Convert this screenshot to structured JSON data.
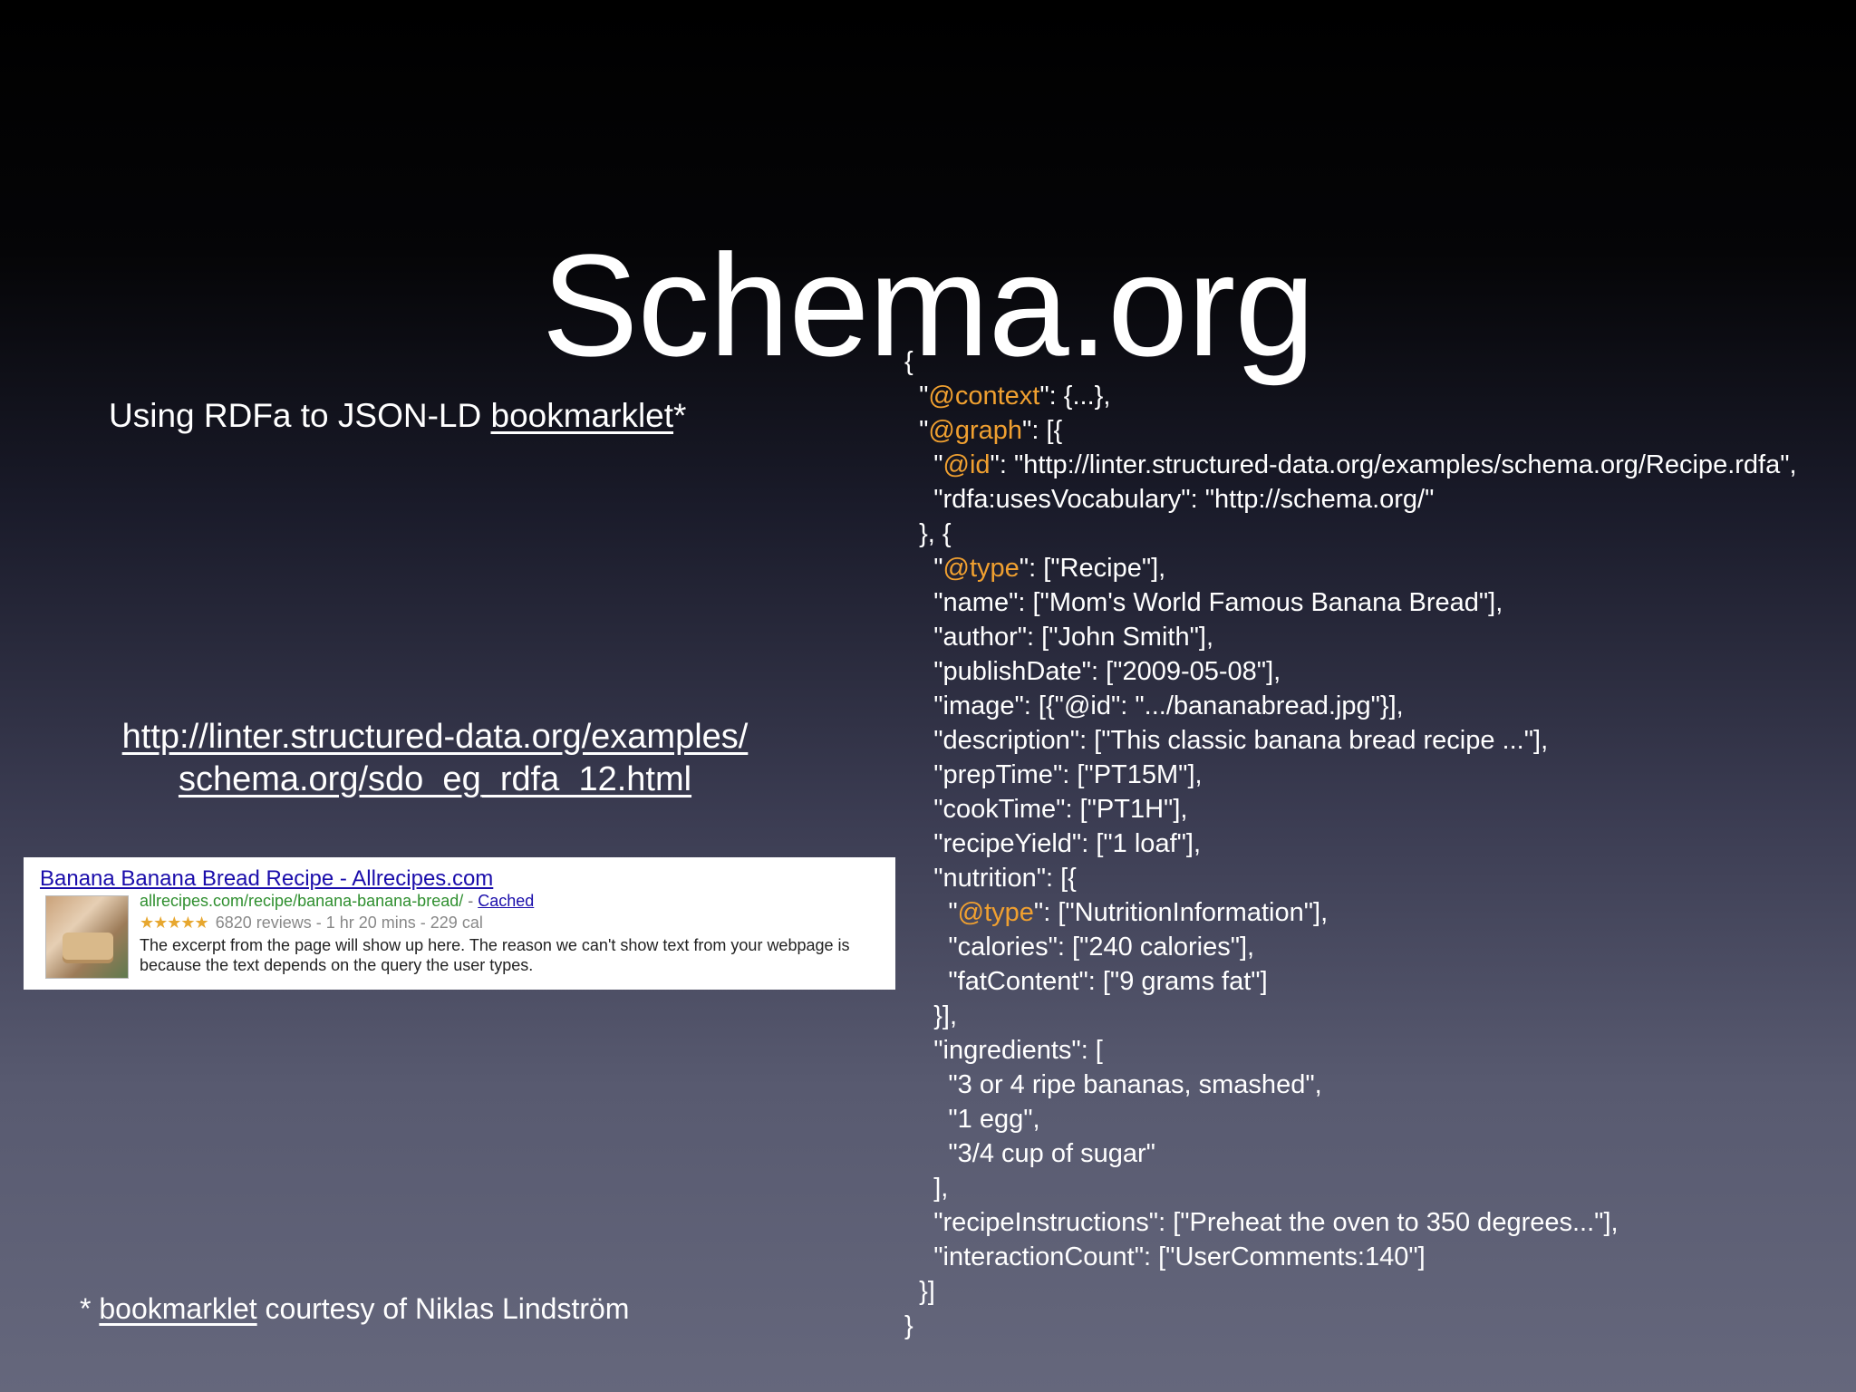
{
  "slide": {
    "title": "Schema.org",
    "subtitle": {
      "prefix": "Using RDFa to JSON-LD ",
      "link": "bookmarklet",
      "suffix": "*"
    },
    "url": {
      "line1": "http://linter.structured-data.org/examples/",
      "line2": "schema.org/sdo_eg_rdfa_12.html"
    },
    "footnote": {
      "prefix": "* ",
      "link": "bookmarklet",
      "suffix": " courtesy of Niklas Lindström"
    }
  },
  "search_result": {
    "title": "Banana Banana Bread Recipe - Allrecipes.com",
    "url": "allrecipes.com/recipe/banana-banana-bread/",
    "separator": " - ",
    "cached_label": "Cached",
    "stars": "★★★★★",
    "meta": "6820 reviews - 1 hr 20 mins - 229 cal",
    "description": "The excerpt from the page will show up here. The reason we can't show text from your webpage is because the text depends on the query the user types.",
    "thumbnail": "banana-bread-photo"
  },
  "code": {
    "lines": [
      {
        "indent": "",
        "key": "",
        "rest": "{"
      },
      {
        "indent": "  ",
        "key": "@context",
        "rest": ": {...},"
      },
      {
        "indent": "  ",
        "key": "@graph",
        "rest": ": [{"
      },
      {
        "indent": "    ",
        "key": "@id",
        "rest": ": \"http://linter.structured-data.org/examples/schema.org/Recipe.rdfa\","
      },
      {
        "indent": "    ",
        "key": "",
        "rest": "\"rdfa:usesVocabulary\": \"http://schema.org/\""
      },
      {
        "indent": "  ",
        "key": "",
        "rest": "}, {"
      },
      {
        "indent": "    ",
        "key": "@type",
        "rest": ": [\"Recipe\"],"
      },
      {
        "indent": "    ",
        "key": "",
        "rest": "\"name\": [\"Mom's World Famous Banana Bread\"],"
      },
      {
        "indent": "    ",
        "key": "",
        "rest": "\"author\": [\"John Smith\"],"
      },
      {
        "indent": "    ",
        "key": "",
        "rest": "\"publishDate\": [\"2009-05-08\"],"
      },
      {
        "indent": "    ",
        "key": "",
        "rest": "\"image\": [{\"@id\": \".../bananabread.jpg\"}],"
      },
      {
        "indent": "    ",
        "key": "",
        "rest": "\"description\": [\"This classic banana bread recipe ...\"],"
      },
      {
        "indent": "    ",
        "key": "",
        "rest": "\"prepTime\": [\"PT15M\"],"
      },
      {
        "indent": "    ",
        "key": "",
        "rest": "\"cookTime\": [\"PT1H\"],"
      },
      {
        "indent": "    ",
        "key": "",
        "rest": "\"recipeYield\": [\"1 loaf\"],"
      },
      {
        "indent": "    ",
        "key": "",
        "rest": "\"nutrition\": [{"
      },
      {
        "indent": "      ",
        "key": "@type",
        "rest": ": [\"NutritionInformation\"],"
      },
      {
        "indent": "      ",
        "key": "",
        "rest": "\"calories\": [\"240 calories\"],"
      },
      {
        "indent": "      ",
        "key": "",
        "rest": "\"fatContent\": [\"9 grams fat\"]"
      },
      {
        "indent": "    ",
        "key": "",
        "rest": "}],"
      },
      {
        "indent": "    ",
        "key": "",
        "rest": "\"ingredients\": ["
      },
      {
        "indent": "      ",
        "key": "",
        "rest": "\"3 or 4 ripe bananas, smashed\","
      },
      {
        "indent": "      ",
        "key": "",
        "rest": "\"1 egg\","
      },
      {
        "indent": "      ",
        "key": "",
        "rest": "\"3/4 cup of sugar\""
      },
      {
        "indent": "    ",
        "key": "",
        "rest": "],"
      },
      {
        "indent": "    ",
        "key": "",
        "rest": "\"recipeInstructions\": [\"Preheat the oven to 350 degrees...\"],"
      },
      {
        "indent": "    ",
        "key": "",
        "rest": "\"interactionCount\": [\"UserComments:140\"]"
      },
      {
        "indent": "  ",
        "key": "",
        "rest": "}]"
      },
      {
        "indent": "",
        "key": "",
        "rest": "}"
      }
    ],
    "highlight_color": "#f0a030"
  }
}
